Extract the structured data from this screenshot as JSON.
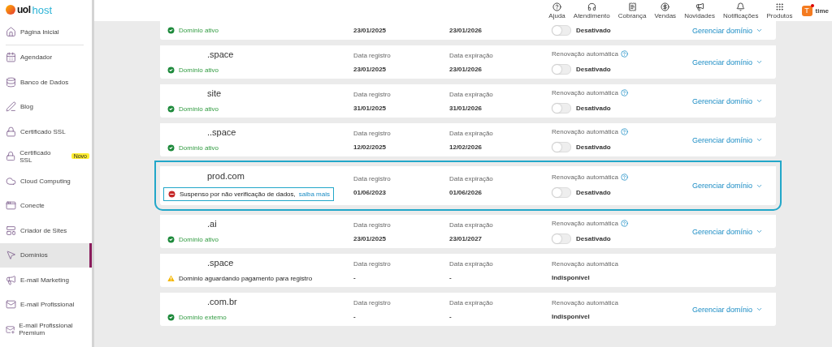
{
  "logo": {
    "brand": "uol",
    "product": "host"
  },
  "sidebar": {
    "items": [
      {
        "label": "Página Inicial",
        "selected": false
      },
      {
        "label": "Agendador",
        "selected": false
      },
      {
        "label": "Banco de Dados",
        "selected": false
      },
      {
        "label": "Blog",
        "selected": false
      },
      {
        "label": "Certificado SSL",
        "selected": false
      },
      {
        "label": "Certificado SSL",
        "selected": false,
        "badge": "Novo"
      },
      {
        "label": "Cloud Computing",
        "selected": false
      },
      {
        "label": "Conecte",
        "selected": false
      },
      {
        "label": "Criador de Sites",
        "selected": false
      },
      {
        "label": "Domínios",
        "selected": true
      },
      {
        "label": "E-mail Marketing",
        "selected": false
      },
      {
        "label": "E-mail Profissional",
        "selected": false
      },
      {
        "label": "E-mail Profissional Premium",
        "selected": false
      }
    ]
  },
  "header": {
    "actions": [
      {
        "label": "Ajuda"
      },
      {
        "label": "Atendimento"
      },
      {
        "label": "Cobrança"
      },
      {
        "label": "Vendas"
      },
      {
        "label": "Novidades"
      },
      {
        "label": "Notificações"
      },
      {
        "label": "Produtos"
      }
    ],
    "user": {
      "initial": "T",
      "name": "time"
    }
  },
  "domains": [
    {
      "status": {
        "kind": "active",
        "text": "Domínio ativo"
      },
      "registered": "23/01/2025",
      "expires": "23/01/2026",
      "renewal": {
        "kind": "toggle",
        "on": false,
        "value": "Desativado"
      },
      "manage": "Gerenciar domínio",
      "highlighted": false
    },
    {
      "name": ".space",
      "status": {
        "kind": "active",
        "text": "Domínio ativo"
      },
      "registered_label": "Data registro",
      "registered": "23/01/2025",
      "expires_label": "Data expiração",
      "expires": "23/01/2026",
      "renewal": {
        "label": "Renovação automática",
        "kind": "toggle",
        "on": false,
        "value": "Desativado"
      },
      "manage": "Gerenciar domínio",
      "highlighted": false
    },
    {
      "name": "site",
      "status": {
        "kind": "active",
        "text": "Domínio ativo"
      },
      "registered_label": "Data registro",
      "registered": "31/01/2025",
      "expires_label": "Data expiração",
      "expires": "31/01/2026",
      "renewal": {
        "label": "Renovação automática",
        "kind": "toggle",
        "on": false,
        "value": "Desativado"
      },
      "manage": "Gerenciar domínio",
      "highlighted": false
    },
    {
      "name": "..space",
      "status": {
        "kind": "active",
        "text": "Domínio ativo"
      },
      "registered_label": "Data registro",
      "registered": "12/02/2025",
      "expires_label": "Data expiração",
      "expires": "12/02/2026",
      "renewal": {
        "label": "Renovação automática",
        "kind": "toggle",
        "on": false,
        "value": "Desativado"
      },
      "manage": "Gerenciar domínio",
      "highlighted": false
    },
    {
      "name": "prod.com",
      "status": {
        "kind": "suspended",
        "text": "Suspenso por não verificação de dados,",
        "link": "saiba mais"
      },
      "registered_label": "Data registro",
      "registered": "01/06/2023",
      "expires_label": "Data expiração",
      "expires": "01/06/2026",
      "renewal": {
        "label": "Renovação automática",
        "kind": "toggle",
        "on": false,
        "value": "Desativado"
      },
      "manage": "Gerenciar domínio",
      "highlighted": true
    },
    {
      "name": ".ai",
      "status": {
        "kind": "active",
        "text": "Domínio ativo"
      },
      "registered_label": "Data registro",
      "registered": "23/01/2025",
      "expires_label": "Data expiração",
      "expires": "23/01/2027",
      "renewal": {
        "label": "Renovação automática",
        "kind": "toggle",
        "on": false,
        "value": "Desativado"
      },
      "manage": "Gerenciar domínio",
      "highlighted": false
    },
    {
      "name": ".space",
      "status": {
        "kind": "pending",
        "text": "Domínio aguardando pagamento para registro"
      },
      "registered_label": "Data registro",
      "registered": "-",
      "expires_label": "Data expiração",
      "expires": "-",
      "renewal": {
        "label": "Renovação automática",
        "kind": "unavailable",
        "value": "Indisponível"
      },
      "highlighted": false
    },
    {
      "name": ".com.br",
      "status": {
        "kind": "external",
        "text": "Domínio externo"
      },
      "registered_label": "Data registro",
      "registered": "-",
      "expires_label": "Data expiração",
      "expires": "-",
      "renewal": {
        "label": "Renovação automática",
        "kind": "unavailable",
        "value": "Indisponível"
      },
      "manage": "Gerenciar domínio",
      "highlighted": false
    }
  ]
}
